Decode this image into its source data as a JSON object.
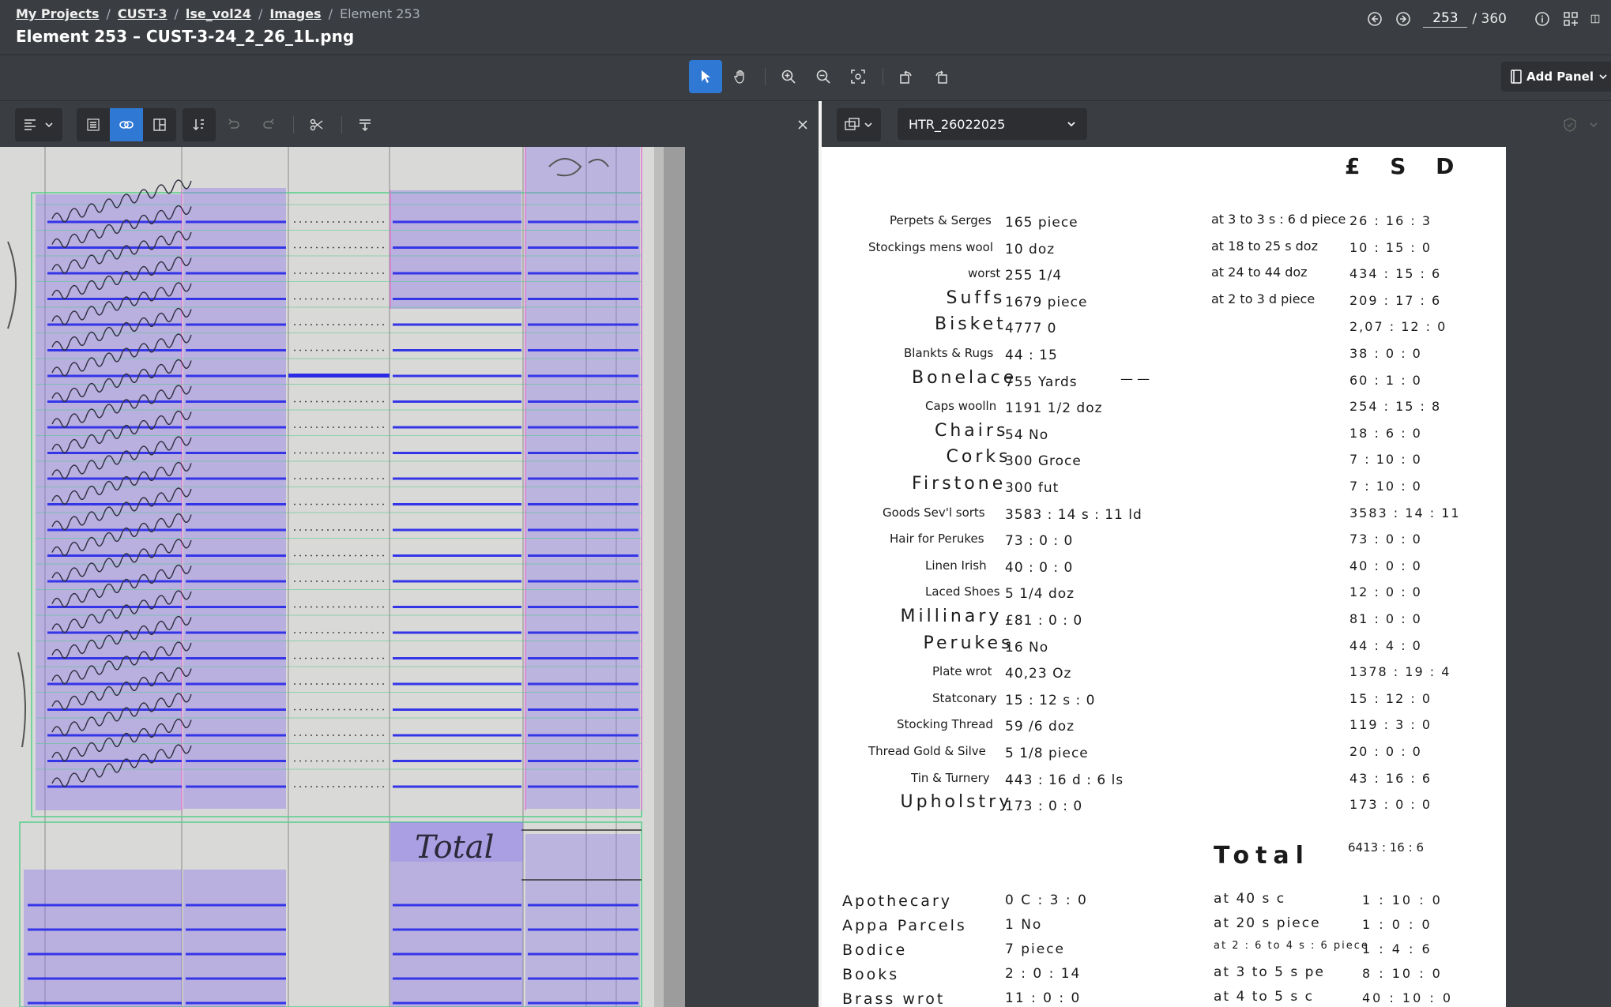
{
  "header": {
    "breadcrumbs": [
      "My Projects",
      "CUST-3",
      "lse_vol24",
      "Images"
    ],
    "current": "Element 253",
    "title": "Element 253 – CUST-3-24_2_26_1L.png",
    "page_value": "253",
    "page_total": "/ 360"
  },
  "toolbar": {
    "add_panel_label": "Add Panel"
  },
  "right_panel": {
    "model_select": "HTR_26022025"
  },
  "transcription": {
    "header_lsd": "£ S D",
    "lines": [
      {
        "item": "Perpets & Serges",
        "qty": "165 piece",
        "rate": "at 3 to 3 s : 6 d piece",
        "value": "26 : 16 : 3"
      },
      {
        "item": "Stockings mens wool",
        "qty": "10 doz",
        "rate": "at 18 to 25 s doz",
        "value": "10 : 15 : 0"
      },
      {
        "item": "worst",
        "qty": "255 1/4",
        "rate": "at 24 to 44 doz",
        "value": "434 : 15 : 6"
      },
      {
        "item": "Suffs",
        "qty": "1679 piece",
        "rate": "at 2 to 3 d piece",
        "value": "209 : 17 : 6"
      },
      {
        "item": "Bisket",
        "qty": "4777 0",
        "rate": "",
        "value": "2,07 : 12 : 0"
      },
      {
        "item": "Blankts & Rugs",
        "qty": "44 : 15",
        "rate": "",
        "value": "38 : 0 : 0"
      },
      {
        "item": "Bonelace",
        "qty": "755 Yards",
        "rate": "— —",
        "value": "60 : 1 : 0"
      },
      {
        "item": "Caps woolln",
        "qty": "1191 1/2 doz",
        "rate": "",
        "value": "254 : 15 : 8"
      },
      {
        "item": "Chairs",
        "qty": "54 No",
        "rate": "",
        "value": "18 : 6 : 0"
      },
      {
        "item": "Corks",
        "qty": "300 Groce",
        "rate": "",
        "value": "7 : 10 : 0"
      },
      {
        "item": "Firstone",
        "qty": "300 fut",
        "rate": "",
        "value": "7 : 10 : 0"
      },
      {
        "item": "Goods Sev'l sorts",
        "qty": "3583 : 14 s : 11 ld",
        "rate": "",
        "value": "3583 : 14 : 11"
      },
      {
        "item": "Hair for Perukes",
        "qty": "73 : 0 : 0",
        "rate": "",
        "value": "73 : 0 : 0"
      },
      {
        "item": "Linen Irish",
        "qty": "40 : 0 : 0",
        "rate": "",
        "value": "40 : 0 : 0"
      },
      {
        "item": "Laced Shoes",
        "qty": "5 1/4 doz",
        "rate": "",
        "value": "12 : 0 : 0"
      },
      {
        "item": "Millinary",
        "qty": "£81 : 0 : 0",
        "rate": "",
        "value": "81 : 0 : 0"
      },
      {
        "item": "Perukes",
        "qty": "16 No",
        "rate": "",
        "value": "44 : 4 : 0"
      },
      {
        "item": "Plate wrot",
        "qty": "40,23 Oz",
        "rate": "",
        "value": "1378 : 19 : 4"
      },
      {
        "item": "Statconary",
        "qty": "15 : 12 s : 0",
        "rate": "",
        "value": "15 : 12 : 0"
      },
      {
        "item": "Stocking Thread",
        "qty": "59 /6 doz",
        "rate": "",
        "value": "119 : 3 : 0"
      },
      {
        "item": "Thread Gold & Silve",
        "qty": "5 1/8 piece",
        "rate": "",
        "value": "20 : 0 : 0"
      },
      {
        "item": "Tin & Turnery",
        "qty": "443 : 16 d : 6 ls",
        "rate": "",
        "value": "43 : 16 : 6"
      },
      {
        "item": "Upholstry",
        "qty": "173 : 0 : 0",
        "rate": "",
        "value": "173 : 0 : 0"
      }
    ],
    "total_label": "Total",
    "total_value": "6413 : 16 : 6",
    "lines2": [
      {
        "item": "Apothecary",
        "qty": "0 C : 3 : 0",
        "rate": "at 40 s c",
        "value": "1 : 10 : 0"
      },
      {
        "item": "Appa Parcels",
        "qty": "1 No",
        "rate": "at 20 s piece",
        "value": "1 : 0 : 0"
      },
      {
        "item": "Bodice",
        "qty": "7 piece",
        "rate": "at 2 : 6 to 4 s : 6 piece",
        "value": "1 : 4 : 6"
      },
      {
        "item": "Books",
        "qty": "2 : 0 : 14",
        "rate": "at 3 to 5 s pe",
        "value": "8 : 10 : 0"
      },
      {
        "item": "Brass wrot",
        "qty": "11 : 0 : 0",
        "rate": "at 4 to 5 s c",
        "value": "40 : 10 : 0"
      }
    ]
  },
  "scan": {
    "total_word": "Total",
    "colors": {
      "line_box": "#7b6fe6",
      "baseline": "#3535e8",
      "row": "#4fd08c",
      "column": "#d67bd0"
    }
  }
}
